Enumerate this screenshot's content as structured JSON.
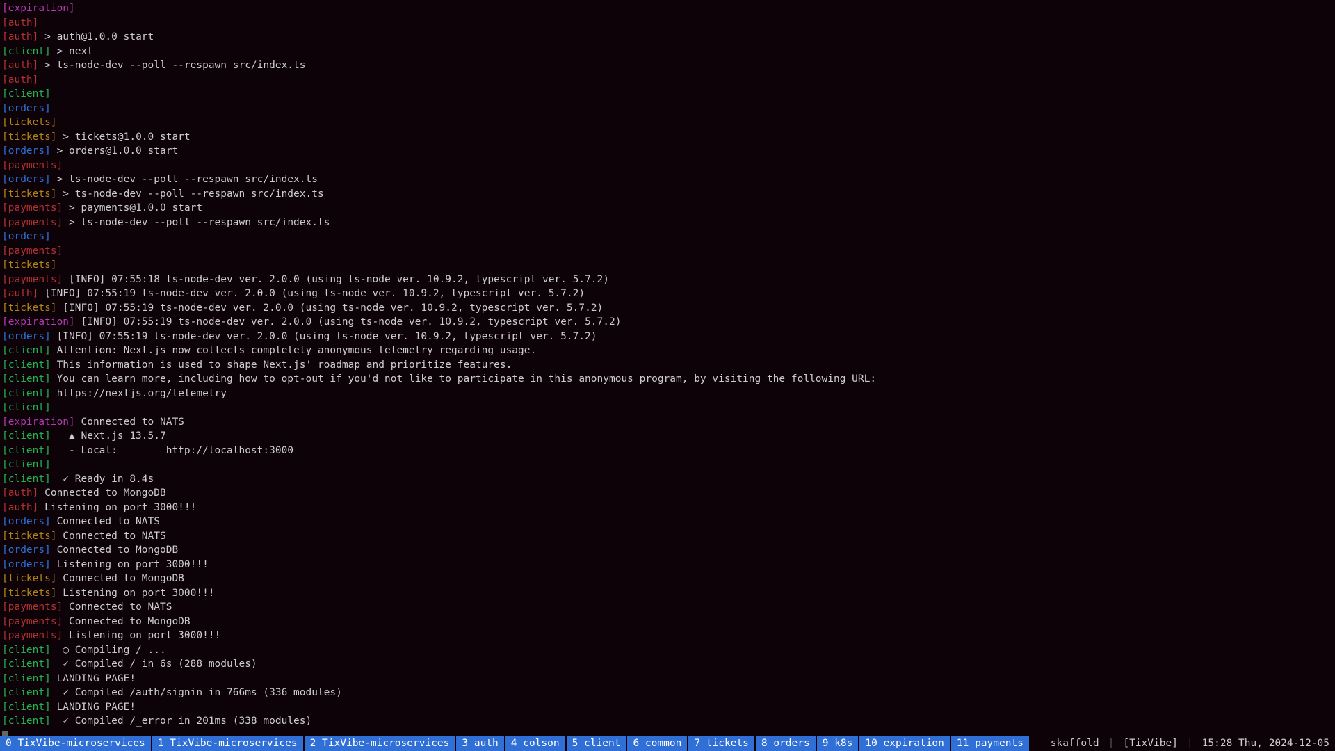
{
  "lines": [
    {
      "tag": "expiration",
      "text": ""
    },
    {
      "tag": "auth",
      "text": ""
    },
    {
      "tag": "auth",
      "text": " > auth@1.0.0 start"
    },
    {
      "tag": "client",
      "text": " > next"
    },
    {
      "tag": "auth",
      "text": " > ts-node-dev --poll --respawn src/index.ts"
    },
    {
      "tag": "auth",
      "text": ""
    },
    {
      "tag": "client",
      "text": ""
    },
    {
      "tag": "orders",
      "text": ""
    },
    {
      "tag": "tickets",
      "text": ""
    },
    {
      "tag": "tickets",
      "text": " > tickets@1.0.0 start"
    },
    {
      "tag": "orders",
      "text": " > orders@1.0.0 start"
    },
    {
      "tag": "payments",
      "text": ""
    },
    {
      "tag": "orders",
      "text": " > ts-node-dev --poll --respawn src/index.ts"
    },
    {
      "tag": "tickets",
      "text": " > ts-node-dev --poll --respawn src/index.ts"
    },
    {
      "tag": "payments",
      "text": " > payments@1.0.0 start"
    },
    {
      "tag": "payments",
      "text": " > ts-node-dev --poll --respawn src/index.ts"
    },
    {
      "tag": "orders",
      "text": ""
    },
    {
      "tag": "payments",
      "text": ""
    },
    {
      "tag": "tickets",
      "text": ""
    },
    {
      "tag": "payments",
      "text": " [INFO] 07:55:18 ts-node-dev ver. 2.0.0 (using ts-node ver. 10.9.2, typescript ver. 5.7.2)"
    },
    {
      "tag": "auth",
      "text": " [INFO] 07:55:19 ts-node-dev ver. 2.0.0 (using ts-node ver. 10.9.2, typescript ver. 5.7.2)"
    },
    {
      "tag": "tickets",
      "text": " [INFO] 07:55:19 ts-node-dev ver. 2.0.0 (using ts-node ver. 10.9.2, typescript ver. 5.7.2)"
    },
    {
      "tag": "expiration",
      "text": " [INFO] 07:55:19 ts-node-dev ver. 2.0.0 (using ts-node ver. 10.9.2, typescript ver. 5.7.2)"
    },
    {
      "tag": "orders",
      "text": " [INFO] 07:55:19 ts-node-dev ver. 2.0.0 (using ts-node ver. 10.9.2, typescript ver. 5.7.2)"
    },
    {
      "tag": "client",
      "text": " Attention: Next.js now collects completely anonymous telemetry regarding usage."
    },
    {
      "tag": "client",
      "text": " This information is used to shape Next.js' roadmap and prioritize features."
    },
    {
      "tag": "client",
      "text": " You can learn more, including how to opt-out if you'd not like to participate in this anonymous program, by visiting the following URL:"
    },
    {
      "tag": "client",
      "text": " https://nextjs.org/telemetry"
    },
    {
      "tag": "client",
      "text": ""
    },
    {
      "tag": "expiration",
      "text": " Connected to NATS"
    },
    {
      "tag": "client",
      "text": "   ▲ Next.js 13.5.7"
    },
    {
      "tag": "client",
      "text": "   - Local:        http://localhost:3000"
    },
    {
      "tag": "client",
      "text": ""
    },
    {
      "tag": "client",
      "text": "  ✓ Ready in 8.4s"
    },
    {
      "tag": "auth",
      "text": " Connected to MongoDB"
    },
    {
      "tag": "auth",
      "text": " Listening on port 3000!!!"
    },
    {
      "tag": "orders",
      "text": " Connected to NATS"
    },
    {
      "tag": "tickets",
      "text": " Connected to NATS"
    },
    {
      "tag": "orders",
      "text": " Connected to MongoDB"
    },
    {
      "tag": "orders",
      "text": " Listening on port 3000!!!"
    },
    {
      "tag": "tickets",
      "text": " Connected to MongoDB"
    },
    {
      "tag": "tickets",
      "text": " Listening on port 3000!!!"
    },
    {
      "tag": "payments",
      "text": " Connected to NATS"
    },
    {
      "tag": "payments",
      "text": " Connected to MongoDB"
    },
    {
      "tag": "payments",
      "text": " Listening on port 3000!!!"
    },
    {
      "tag": "client",
      "text": "  ○ Compiling / ..."
    },
    {
      "tag": "client",
      "text": "  ✓ Compiled / in 6s (288 modules)"
    },
    {
      "tag": "client",
      "text": " LANDING PAGE!"
    },
    {
      "tag": "client",
      "text": "  ✓ Compiled /auth/signin in 766ms (336 modules)"
    },
    {
      "tag": "client",
      "text": " LANDING PAGE!"
    },
    {
      "tag": "client",
      "text": "  ✓ Compiled /_error in 201ms (338 modules)"
    }
  ],
  "tag_labels": {
    "expiration": "[expiration]",
    "auth": "[auth]",
    "client": "[client]",
    "orders": "[orders]",
    "tickets": "[tickets]",
    "payments": "[payments]"
  },
  "statusbar": {
    "windows": [
      {
        "label": "0 TixVibe-microservices"
      },
      {
        "label": "1 TixVibe-microservices"
      },
      {
        "label": "2 TixVibe-microservices"
      },
      {
        "label": "3 auth"
      },
      {
        "label": "4 colson"
      },
      {
        "label": "5 client"
      },
      {
        "label": "6 common"
      },
      {
        "label": "7 tickets"
      },
      {
        "label": "8 orders"
      },
      {
        "label": "9 k8s"
      },
      {
        "label": "10 expiration"
      },
      {
        "label": "11 payments"
      }
    ],
    "right": {
      "mode": "skaffold",
      "session": "[TixVibe]",
      "datetime": "15:28 Thu, 2024-12-05"
    }
  }
}
